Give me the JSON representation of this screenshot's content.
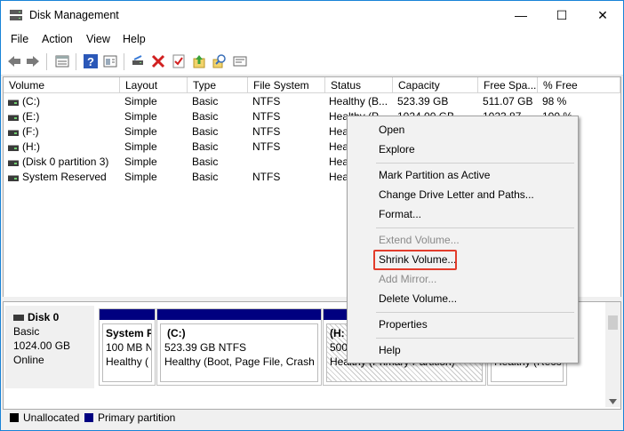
{
  "window": {
    "title": "Disk Management",
    "controls": {
      "minimize": "—",
      "maximize": "☐",
      "close": "✕"
    }
  },
  "menu": [
    "File",
    "Action",
    "View",
    "Help"
  ],
  "toolbar": {
    "icons": [
      "back-icon",
      "forward-icon",
      "list-view-icon",
      "help-icon",
      "show-hide-icon",
      "connect-icon",
      "delete-icon",
      "check-icon",
      "upload-icon",
      "search-icon",
      "properties-icon"
    ]
  },
  "volumes_table": {
    "columns": [
      "Volume",
      "Layout",
      "Type",
      "File System",
      "Status",
      "Capacity",
      "Free Spa...",
      "% Free"
    ],
    "rows": [
      [
        "(C:)",
        "Simple",
        "Basic",
        "NTFS",
        "Healthy (B...",
        "523.39 GB",
        "511.07 GB",
        "98 %"
      ],
      [
        "(E:)",
        "Simple",
        "Basic",
        "NTFS",
        "Healthy (P...",
        "1024.00 GB",
        "1023.87 ...",
        "100 %"
      ],
      [
        "(F:)",
        "Simple",
        "Basic",
        "NTFS",
        "Hea",
        "",
        "",
        ""
      ],
      [
        "(H:)",
        "Simple",
        "Basic",
        "NTFS",
        "Hea",
        "",
        "",
        ""
      ],
      [
        "(Disk 0 partition 3)",
        "Simple",
        "Basic",
        "",
        "Hea",
        "",
        "",
        ""
      ],
      [
        "System Reserved",
        "Simple",
        "Basic",
        "NTFS",
        "Hea",
        "",
        "",
        ""
      ]
    ]
  },
  "disk": {
    "name": "Disk 0",
    "type": "Basic",
    "size": "1024.00 GB",
    "state": "Online",
    "partitions": [
      {
        "name": "System F",
        "line2": "100 MB N",
        "line3": "Healthy ("
      },
      {
        "name": "(C:)",
        "line2": "523.39 GB NTFS",
        "line3": "Healthy (Boot, Page File, Crash D"
      },
      {
        "name": "(H:",
        "line2": "500.",
        "line3": "Healthy (Primary Partition)"
      },
      {
        "name": "",
        "line2": "",
        "line3": "Healthy (Reco"
      }
    ]
  },
  "legend": [
    {
      "label": "Unallocated",
      "color": "#000000"
    },
    {
      "label": "Primary partition",
      "color": "#000080"
    }
  ],
  "context_menu": {
    "items": [
      {
        "label": "Open",
        "enabled": true
      },
      {
        "label": "Explore",
        "enabled": true
      },
      {
        "label": "Mark Partition as Active",
        "enabled": true
      },
      {
        "label": "Change Drive Letter and Paths...",
        "enabled": true
      },
      {
        "label": "Format...",
        "enabled": true
      },
      {
        "label": "Extend Volume...",
        "enabled": false
      },
      {
        "label": "Shrink Volume...",
        "enabled": true,
        "highlighted": true
      },
      {
        "label": "Add Mirror...",
        "enabled": false
      },
      {
        "label": "Delete Volume...",
        "enabled": true
      },
      {
        "label": "Properties",
        "enabled": true
      },
      {
        "label": "Help",
        "enabled": true
      }
    ],
    "highlight_color": "#e23c2b"
  }
}
